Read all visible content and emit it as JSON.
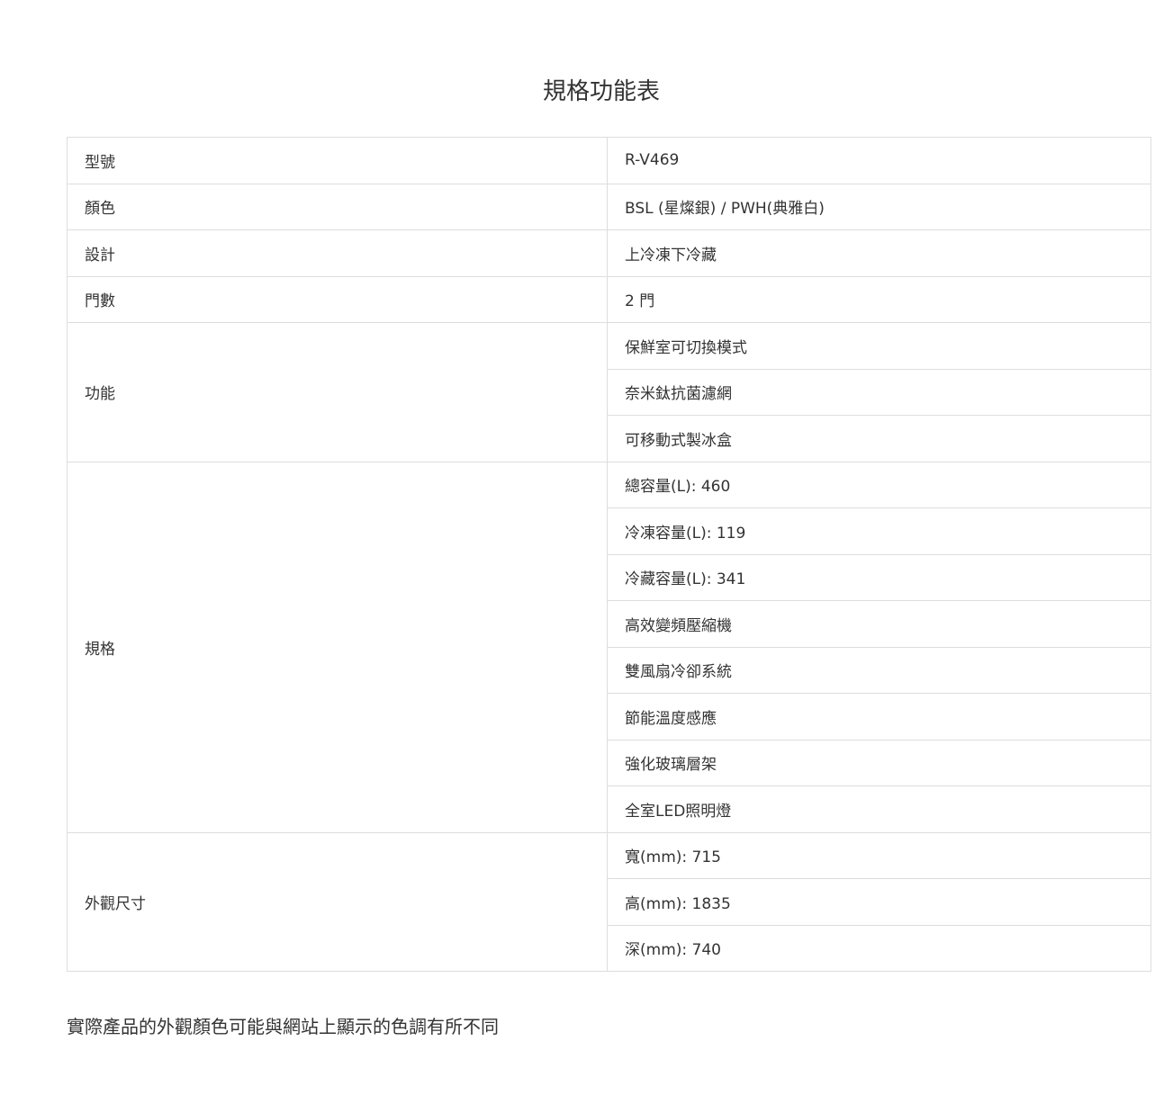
{
  "page": {
    "title": "規格功能表",
    "disclaimer": "實際產品的外觀顏色可能與網站上顯示的色調有所不同"
  },
  "spec_table": {
    "rows": [
      {
        "label": "型號",
        "values": [
          "R-V469"
        ]
      },
      {
        "label": "顏色",
        "values": [
          "BSL (星燦銀) / PWH(典雅白)"
        ]
      },
      {
        "label": "設計",
        "values": [
          "上冷凍下冷藏"
        ]
      },
      {
        "label": "門數",
        "values": [
          "2 門"
        ]
      },
      {
        "label": "功能",
        "values": [
          "保鮮室可切換模式",
          "奈米鈦抗菌濾網",
          "可移動式製冰盒"
        ]
      },
      {
        "label": "規格",
        "values": [
          "總容量(L): 460",
          "冷凍容量(L): 119",
          "冷藏容量(L): 341",
          "高效變頻壓縮機",
          "雙風扇冷卻系統",
          "節能溫度感應",
          "強化玻璃層架",
          "全室LED照明燈"
        ]
      },
      {
        "label": "外觀尺寸",
        "values": [
          "寬(mm): 715",
          "高(mm): 1835",
          "深(mm): 740"
        ]
      }
    ]
  },
  "colors": {
    "text": "#333333",
    "border": "#dddddd",
    "background": "#ffffff"
  }
}
